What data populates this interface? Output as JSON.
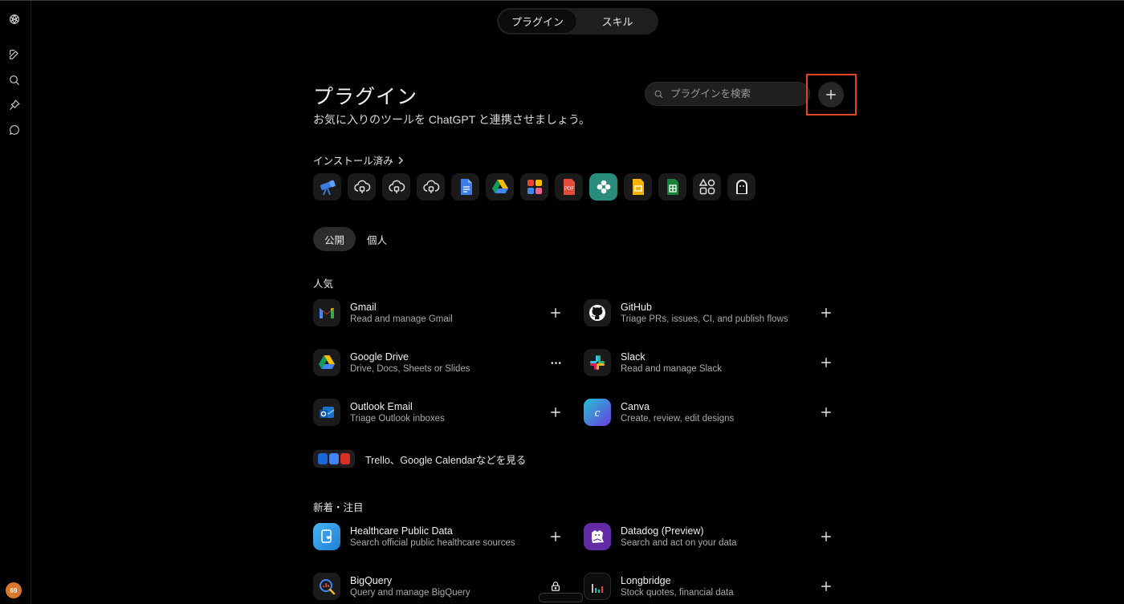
{
  "toggle": {
    "plugins": "プラグイン",
    "skills": "スキル"
  },
  "header": {
    "title": "プラグイン",
    "subtitle": "お気に入りのツールを ChatGPT と連携させましょう。",
    "search_placeholder": "プラグインを検索"
  },
  "installed": {
    "heading": "インストール済み",
    "icons": [
      "telescope-icon",
      "cloud-plug-icon",
      "cloud-plug-icon",
      "cloud-plug-icon",
      "google-docs-icon",
      "google-drive-icon",
      "photos-icon",
      "pdf-icon",
      "clover-icon",
      "slides-icon",
      "sheets-icon",
      "apps-grid-icon",
      "mascot-icon"
    ]
  },
  "tabs": {
    "public": "公開",
    "personal": "個人"
  },
  "popular": {
    "heading": "人気",
    "items": [
      {
        "name": "Gmail",
        "desc": "Read and manage Gmail",
        "icon": "gmail-icon",
        "action": "add"
      },
      {
        "name": "GitHub",
        "desc": "Triage PRs, issues, CI, and publish flows",
        "icon": "github-icon",
        "action": "add"
      },
      {
        "name": "Google Drive",
        "desc": "Drive, Docs, Sheets or Slides",
        "icon": "google-drive-icon",
        "action": "more"
      },
      {
        "name": "Slack",
        "desc": "Read and manage Slack",
        "icon": "slack-icon",
        "action": "add"
      },
      {
        "name": "Outlook Email",
        "desc": "Triage Outlook inboxes",
        "icon": "outlook-icon",
        "action": "add"
      },
      {
        "name": "Canva",
        "desc": "Create, review, edit designs",
        "icon": "canva-icon",
        "action": "add"
      }
    ],
    "more_text": "Trello、Google Calendarなどを見る"
  },
  "featured": {
    "heading": "新着・注目",
    "items": [
      {
        "name": "Healthcare Public Data",
        "desc": "Search official public healthcare sources",
        "icon": "healthcare-icon",
        "action": "add"
      },
      {
        "name": "Datadog (Preview)",
        "desc": "Search and act on your data",
        "icon": "datadog-icon",
        "action": "add"
      },
      {
        "name": "BigQuery",
        "desc": "Query and manage BigQuery",
        "icon": "bigquery-icon",
        "action": "lock"
      },
      {
        "name": "Longbridge",
        "desc": "Stock quotes, financial data",
        "icon": "longbridge-icon",
        "action": "add"
      }
    ]
  },
  "user": {
    "avatar_text": "69",
    "avatar_color": "#d9782d"
  },
  "colors": {
    "highlight": "#e0452c",
    "background": "#000000"
  }
}
